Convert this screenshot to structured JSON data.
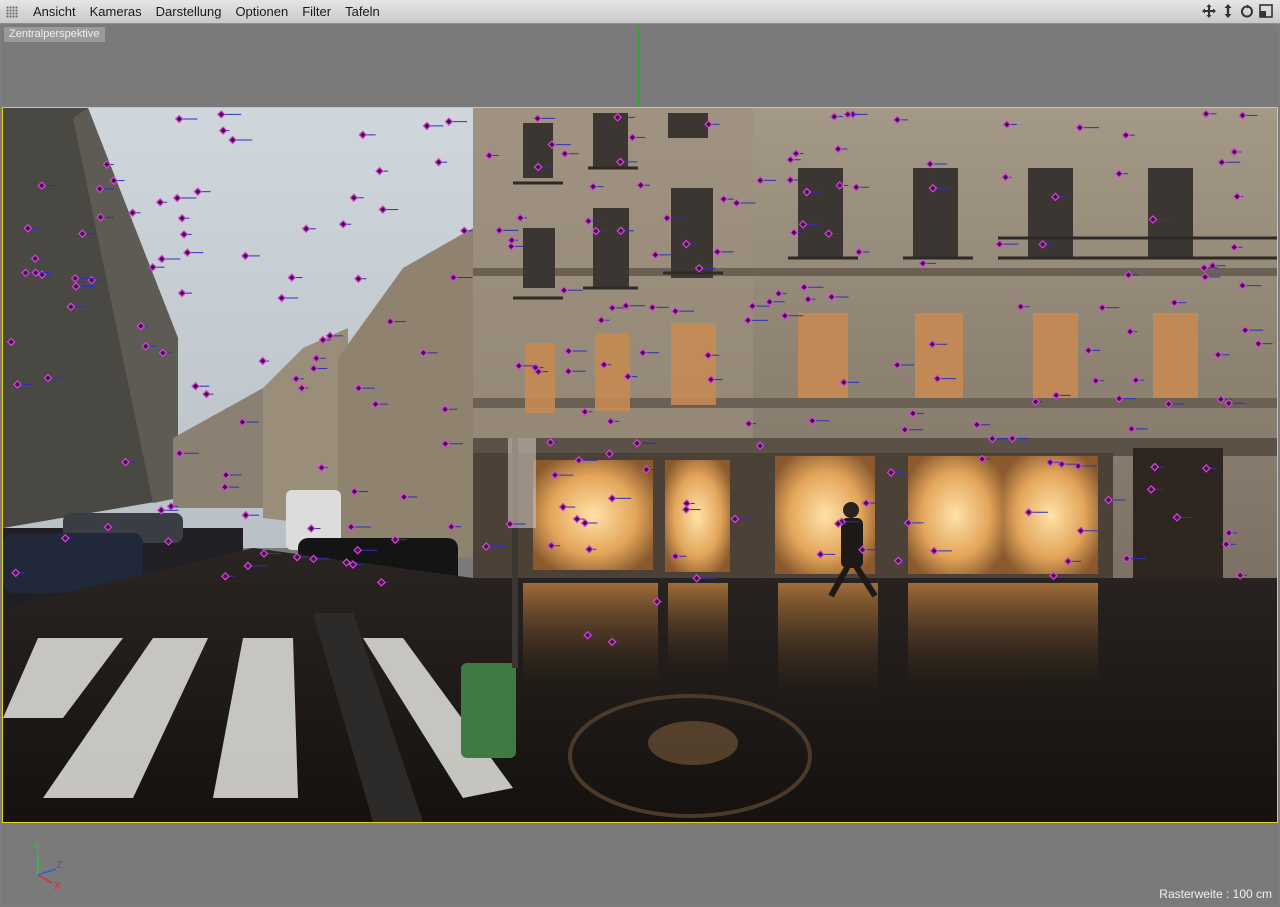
{
  "menu": {
    "items": [
      "Ansicht",
      "Kameras",
      "Darstellung",
      "Optionen",
      "Filter",
      "Tafeln"
    ]
  },
  "nav_icons": [
    "move-icon",
    "zoom-icon",
    "rotate-icon",
    "maximize-icon"
  ],
  "viewport": {
    "camera_label": "Zentralperspektive",
    "frame_color": "#e8d11e",
    "grid_status": "Rasterweite : 100 cm"
  },
  "axis_gizmo": {
    "y": "Y",
    "z": "Z",
    "x": "X"
  },
  "tracking": {
    "marker_color": "#e040e0",
    "line_color": "#2f2fb8"
  }
}
